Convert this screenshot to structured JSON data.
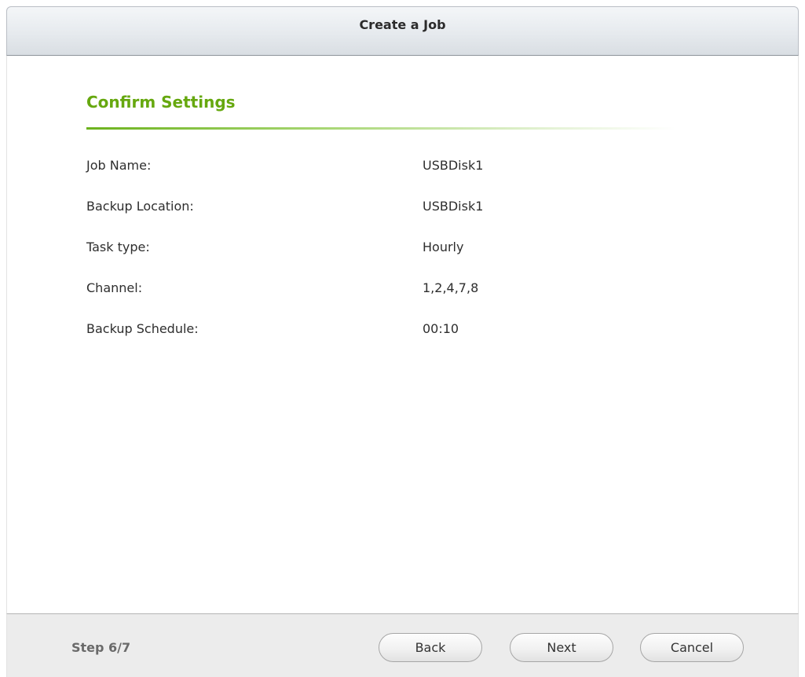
{
  "window": {
    "title": "Create a Job"
  },
  "section": {
    "title": "Confirm Settings"
  },
  "settings": [
    {
      "label": "Job Name:",
      "value": "USBDisk1"
    },
    {
      "label": "Backup Location:",
      "value": "USBDisk1"
    },
    {
      "label": "Task type:",
      "value": "Hourly"
    },
    {
      "label": "Channel:",
      "value": "1,2,4,7,8"
    },
    {
      "label": "Backup Schedule:",
      "value": "00:10"
    }
  ],
  "footer": {
    "step": "Step 6/7",
    "back_label": "Back",
    "next_label": "Next",
    "cancel_label": "Cancel"
  },
  "colors": {
    "accent_green": "#66a80f"
  }
}
